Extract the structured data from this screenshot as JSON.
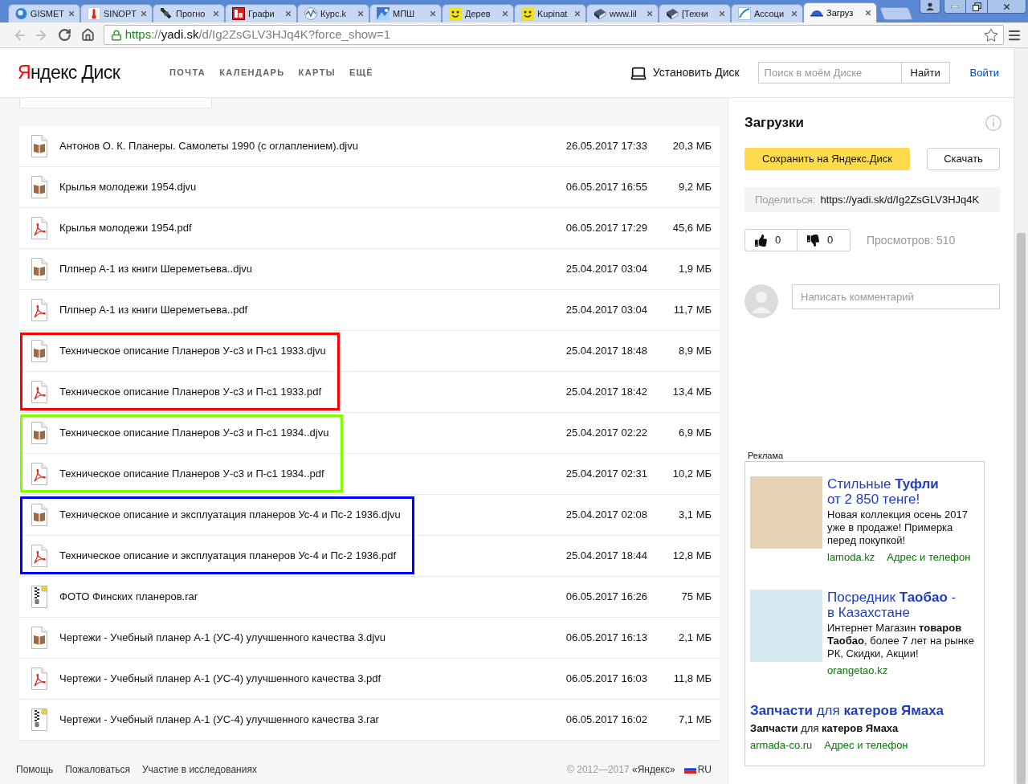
{
  "browser": {
    "tabs": [
      {
        "label": "GISMET",
        "selected": false
      },
      {
        "label": "SINOPT",
        "selected": false
      },
      {
        "label": "Прогно",
        "selected": false
      },
      {
        "label": "Графи",
        "selected": false
      },
      {
        "label": "Курс.k",
        "selected": false
      },
      {
        "label": "МПШ",
        "selected": false
      },
      {
        "label": "Дерев",
        "selected": false
      },
      {
        "label": "Kupinat",
        "selected": false
      },
      {
        "label": "www.lil",
        "selected": false
      },
      {
        "label": "[Техни",
        "selected": false
      },
      {
        "label": "Ассоци",
        "selected": false
      },
      {
        "label": "Загруз",
        "selected": true
      }
    ],
    "address_bar": {
      "url_parts": [
        {
          "kind": "scheme",
          "text": "https"
        },
        {
          "kind": "path",
          "text": "://"
        },
        {
          "kind": "host",
          "text": "yadi.sk"
        },
        {
          "kind": "path",
          "text": "/d/Ig2ZsGLV3HJq4K?force_show=1"
        }
      ]
    }
  },
  "header": {
    "logo": "Яндекс Диск",
    "nav": [
      "ПОЧТА",
      "КАЛЕНДАРЬ",
      "КАРТЫ",
      "ЕЩЁ"
    ],
    "install": "Установить Диск",
    "search": {
      "placeholder": "Поиск в моём Диске",
      "button": "Найти"
    },
    "login": "Войти"
  },
  "file_list": {
    "items": [
      {
        "kind": "djvu",
        "name": "Антонов О. К. Планеры. Самолеты 1990 (с оглаплением).djvu",
        "modified": "26.05.2017 17:33",
        "size": "20,3 МБ"
      },
      {
        "kind": "djvu",
        "name": "Крылья молодежи 1954.djvu",
        "modified": "06.05.2017 16:55",
        "size": "9,2 МБ"
      },
      {
        "kind": "pdf",
        "name": "Крылья молодежи 1954.pdf",
        "modified": "06.05.2017 17:29",
        "size": "45,6 МБ"
      },
      {
        "kind": "djvu",
        "name": "Плпнер А-1 из книги Шереметьева..djvu",
        "modified": "25.04.2017 03:04",
        "size": "1,9 МБ"
      },
      {
        "kind": "pdf",
        "name": "Плпнер А-1 из книги Шереметьева..pdf",
        "modified": "25.04.2017 03:04",
        "size": "11,7 МБ"
      },
      {
        "kind": "marked_group",
        "color": "#ff0000",
        "files": [
          {
            "kind": "djvu",
            "name": "Техническое описание Планеров У-с3 и П-с1 1933.djvu",
            "modified": "25.04.2017 18:48",
            "size": "8,9 МБ"
          },
          {
            "kind": "pdf",
            "name": "Техническое описание Планеров У-с3 и П-с1 1933.pdf",
            "modified": "25.04.2017 18:42",
            "size": "13,4 МБ"
          }
        ]
      },
      {
        "kind": "marked_group",
        "color": "#80ff00",
        "files": [
          {
            "kind": "djvu",
            "name": "Техническое описание Планеров У-с3 и П-с1 1934..djvu",
            "modified": "25.04.2017 02:22",
            "size": "6,9 МБ"
          },
          {
            "kind": "pdf",
            "name": "Техническое описание Планеров У-с3 и П-с1 1934..pdf",
            "modified": "25.04.2017 02:31",
            "size": "10,2 МБ"
          }
        ]
      },
      {
        "kind": "marked_group",
        "color": "#0000ff",
        "files": [
          {
            "kind": "djvu",
            "name": "Техническое описание и эксплуатация планеров Ус-4 и Пс-2 1936.djvu",
            "modified": "25.04.2017 02:08",
            "size": "3,1 МБ"
          },
          {
            "kind": "pdf",
            "name": "Техническое описание и эксплуатация планеров Ус-4 и Пс-2 1936.pdf",
            "modified": "25.04.2017 18:44",
            "size": "12,8 МБ"
          }
        ]
      },
      {
        "kind": "rar",
        "name": "ФОТО Финских планеров.rar",
        "modified": "06.05.2017 16:26",
        "size": "75 МБ"
      },
      {
        "kind": "djvu",
        "name": "Чертежи - Учебный планер А-1 (УС-4) улучшенного качества 3.djvu",
        "modified": "06.05.2017 16:13",
        "size": "2,1 МБ"
      },
      {
        "kind": "pdf",
        "name": "Чертежи - Учебный планер А-1 (УС-4) улучшенного качества 3.pdf",
        "modified": "06.05.2017 16:03",
        "size": "11,8 МБ"
      },
      {
        "kind": "rar",
        "name": "Чертежи - Учебный планер А-1 (УС-4) улучшенного качества 3.rar",
        "modified": "06.05.2017 16:02",
        "size": "7,1 МБ"
      }
    ]
  },
  "sidebar": {
    "title": "Загрузки",
    "save_button": "Сохранить на Яндекс.Диск",
    "download_button": "Скачать",
    "share": {
      "label": "Поделиться:",
      "url": "https://yadi.sk/d/Ig2ZsGLV3HJq4K"
    },
    "likes": "0",
    "dislikes": "0",
    "views": "Просмотров: 510",
    "comment": {
      "placeholder": "Написать комментарий"
    }
  },
  "ads": {
    "label": "Реклама",
    "items": [
      {
        "kind": "image",
        "title_lines": [
          "Стильные **Туфли**",
          "от 2 850 тенге!"
        ],
        "text": "Новая коллекция осень 2017 уже в продаже! Примерка перед покупкой!",
        "links": [
          "lamoda.kz",
          "Адрес и телефон"
        ]
      },
      {
        "kind": "image",
        "title_lines": [
          "Посредник **Таобао** -",
          "в Казахстане"
        ],
        "text": "Интернет Магазин **товаров Таобао**, более 7 лет на рынке РК, Скидки, Акции!",
        "links": [
          "orangetao.kz"
        ]
      },
      {
        "kind": "text",
        "title_lines": [
          "**Запчасти** для **катеров Ямаха**"
        ],
        "text": "**Запчасти** для **катеров Ямаха**",
        "links": [
          "armada-co.ru",
          "Адрес и телефон"
        ]
      }
    ]
  },
  "footer": {
    "links": [
      "Помощь",
      "Пожаловаться",
      "Участие в исследованиях"
    ],
    "copyright": {
      "years": "© 2012—2017",
      "holder": "«Яндекс»"
    },
    "language": "RU"
  }
}
